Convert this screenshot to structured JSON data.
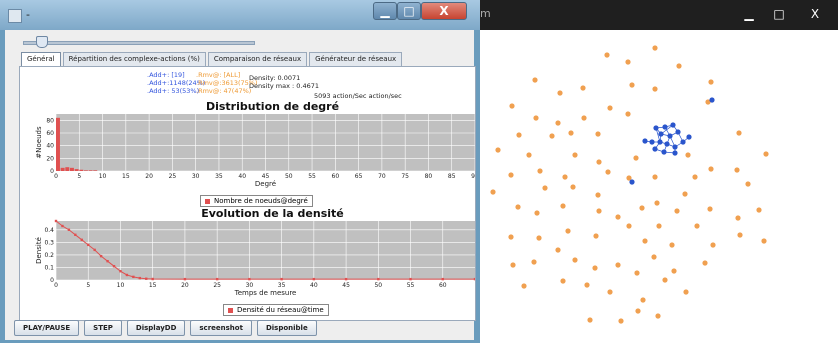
{
  "left_window": {
    "title": "-",
    "controls": {
      "minimize": "▁",
      "maximize": "□",
      "close": "X"
    }
  },
  "tabs": [
    "Général",
    "Répartition des complexe-actions (%)",
    "Comparaison de réseaux",
    "Générateur de réseaux"
  ],
  "stats": {
    "add_all": ".Add+: [19]",
    "rmv_all": ".Rmv@: [ALL]",
    "add_2": ".Add+:1148(24%)",
    "rmv_2": ".Rmv@:3613(75%)",
    "add_3": ".Add+: 53(53%)",
    "rmv_3": ".Rmv@: 47(47%)",
    "density": "Density: 0.0071",
    "density_max": "Density max : 0.4671",
    "rate": "5093 action/Sec action/sec"
  },
  "colors": {
    "series": "#e05050",
    "plot_bg": "#c0c0c0",
    "node_orange": "#f0a050",
    "node_blue": "#2a55cc"
  },
  "chart_data": [
    {
      "type": "bar",
      "title": "Distribution de degré",
      "xlabel": "Degré",
      "ylabel": "#Noeuds",
      "xlim": [
        0,
        90
      ],
      "ylim": [
        0,
        90
      ],
      "xticks": [
        0,
        5,
        10,
        15,
        20,
        25,
        30,
        35,
        40,
        45,
        50,
        55,
        60,
        65,
        70,
        75,
        80,
        85,
        90
      ],
      "yticks": [
        0,
        20,
        40,
        60,
        80
      ],
      "series": [
        {
          "name": "Nombre de noeuds@degré",
          "x": [
            0,
            1,
            2,
            3,
            4,
            5,
            6,
            7,
            8,
            9,
            10
          ],
          "values": [
            84,
            5,
            6,
            5,
            3,
            2,
            1,
            1,
            1,
            0,
            0
          ]
        }
      ]
    },
    {
      "type": "line",
      "title": "Evolution de la densité",
      "xlabel": "Temps de mesure",
      "ylabel": "Densité",
      "xlim": [
        0,
        65
      ],
      "ylim": [
        0,
        0.47
      ],
      "xticks": [
        0,
        5,
        10,
        15,
        20,
        25,
        30,
        35,
        40,
        45,
        50,
        55,
        60
      ],
      "yticks": [
        0.0,
        0.1,
        0.2,
        0.3,
        0.4
      ],
      "series": [
        {
          "name": "Densité du réseau@time",
          "x": [
            0,
            1,
            2,
            3,
            4,
            5,
            6,
            7,
            8,
            9,
            10,
            11,
            12,
            13,
            14,
            15,
            20,
            25,
            30,
            35,
            40,
            45,
            50,
            55,
            60,
            65
          ],
          "values": [
            0.47,
            0.43,
            0.4,
            0.36,
            0.32,
            0.28,
            0.24,
            0.19,
            0.15,
            0.11,
            0.07,
            0.04,
            0.025,
            0.015,
            0.01,
            0.008,
            0.007,
            0.007,
            0.007,
            0.007,
            0.007,
            0.007,
            0.007,
            0.007,
            0.007,
            0.007
          ]
        }
      ]
    }
  ],
  "buttons": [
    "PLAY/PAUSE",
    "STEP",
    "DisplayDD",
    "screenshot",
    "Disponible"
  ],
  "right_window": {
    "title": "m",
    "controls": {
      "minimize": "▁",
      "maximize": "□",
      "close": "X"
    }
  }
}
